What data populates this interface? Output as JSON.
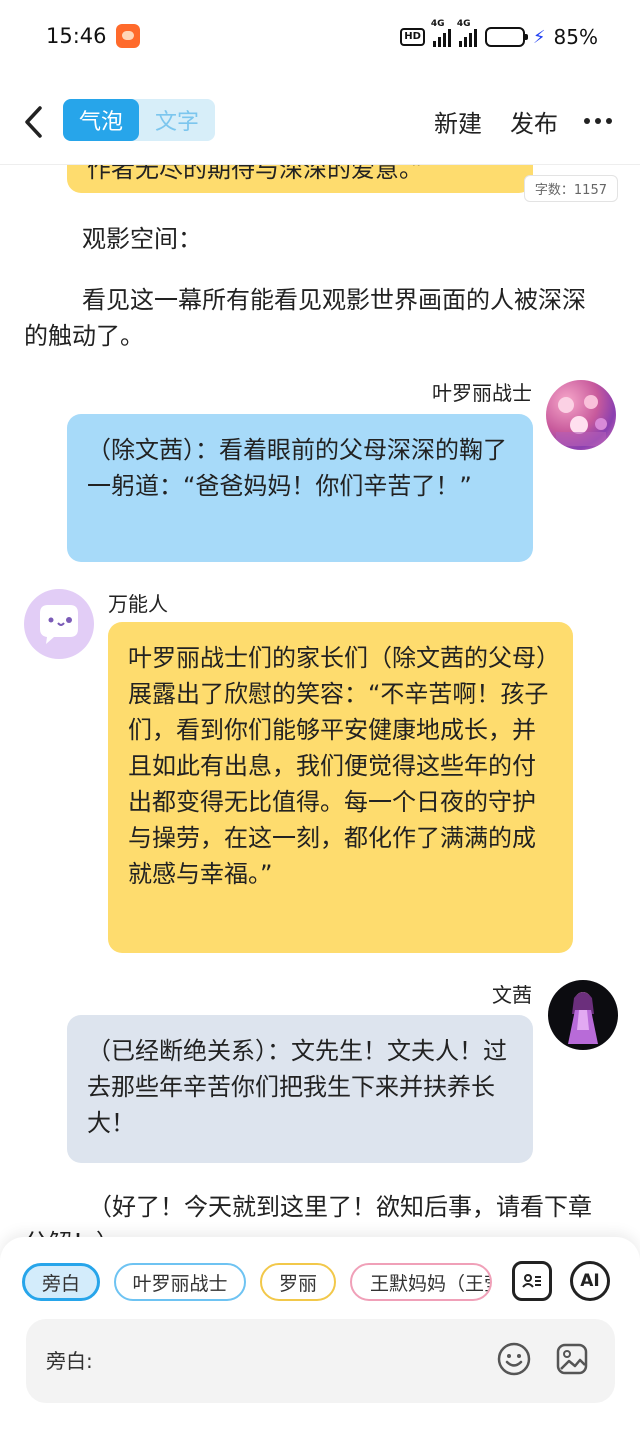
{
  "status_bar": {
    "time": "15:46",
    "hd": "HD",
    "signal1": "4G",
    "signal2": "4G",
    "battery_percent": "85%",
    "battery_level": 0.85,
    "charging_icon": "bolt-icon"
  },
  "toolbar": {
    "back_icon": "chevron-left-icon",
    "mode_tabs": [
      "气泡",
      "文字"
    ],
    "active_mode": "气泡",
    "new_label": "新建",
    "publish_label": "发布",
    "more_icon": "more-horizontal-icon"
  },
  "content": {
    "word_count": "字数：1157",
    "top_bubble_partial": "作者无尽的期待与深深的爱意。”",
    "narration_1": "观影空间：",
    "narration_2": "看见这一幕所有能看见观影世界画面的人被深深的触动了。",
    "messages": [
      {
        "speaker": "叶罗丽战士",
        "side": "right",
        "text": "（除文茜）：看着眼前的父母深深的鞠了一躬道：“爸爸妈妈！你们辛苦了！”"
      },
      {
        "speaker": "万能人",
        "side": "left",
        "text": "叶罗丽战士们的家长们（除文茜的父母）展露出了欣慰的笑容：“不辛苦啊！孩子们，看到你们能够平安健康地成长，并且如此有出息，我们便觉得这些年的付出都变得无比值得。每一个日夜的守护与操劳，在这一刻，都化作了满满的成就感与幸福。”"
      },
      {
        "speaker": "文茜",
        "side": "right",
        "text": "（已经断绝关系）：文先生！文夫人！过去那些年辛苦你们把我生下来并扶养长大！"
      }
    ],
    "narration_3": "（好了！今天就到这里了！欲知后事，请看下章分解！）"
  },
  "bottom": {
    "chips": [
      "旁白",
      "叶罗丽战士",
      "罗丽",
      "王默妈妈（王莹）"
    ],
    "selected_chip": "旁白",
    "role_icon": "role-card-icon",
    "ai_label": "AI",
    "input_label": "旁白:",
    "emoji_icon": "emoji-icon",
    "image_icon": "image-icon"
  },
  "colors": {
    "accent": "#27a5ea",
    "bubble_yellow": "#fedc6e",
    "bubble_blue": "#a7daf9",
    "bubble_gray": "#dde4ee"
  }
}
